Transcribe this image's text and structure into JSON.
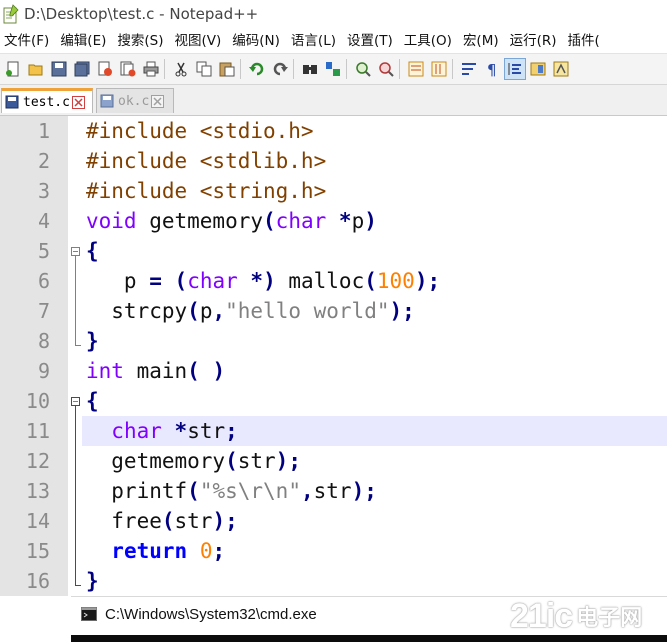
{
  "window": {
    "title": "D:\\Desktop\\test.c - Notepad++"
  },
  "menu": [
    "文件(F)",
    "编辑(E)",
    "搜索(S)",
    "视图(V)",
    "编码(N)",
    "语言(L)",
    "设置(T)",
    "工具(O)",
    "宏(M)",
    "运行(R)",
    "插件("
  ],
  "toolbar": {
    "icons": [
      "new-file-icon",
      "open-file-icon",
      "save-icon",
      "save-all-icon",
      "close-icon",
      "close-all-icon",
      "print-icon",
      "cut-icon",
      "copy-icon",
      "paste-icon",
      "undo-icon",
      "redo-icon",
      "find-icon",
      "replace-icon",
      "zoom-in-icon",
      "zoom-out-icon",
      "sync-vertical-icon",
      "sync-horizontal-icon",
      "word-wrap-icon",
      "show-all-chars-icon",
      "indent-guide-icon",
      "document-map-icon",
      "function-list-icon"
    ]
  },
  "tabs": [
    {
      "label": "test.c",
      "active": true
    },
    {
      "label": "ok.c",
      "active": false
    }
  ],
  "editor": {
    "line_numbers": [
      "1",
      "2",
      "3",
      "4",
      "5",
      "6",
      "7",
      "8",
      "9",
      "10",
      "11",
      "12",
      "13",
      "14",
      "15",
      "16"
    ],
    "current_line": 11
  },
  "cmd": {
    "title": "C:\\Windows\\System32\\cmd.exe"
  },
  "watermark": {
    "logo_text": "21ic",
    "cn_text": "电子网"
  },
  "colors": {
    "preprocessor": "#804000",
    "type_keyword": "#8000ff",
    "instruction_keyword": "#0000ff",
    "string": "#808080",
    "number": "#ff8000",
    "operator": "#000080",
    "current_line_bg": "#e8e8ff",
    "gutter_bg": "#e4e4e4",
    "tab_active_accent": "#f0a23a",
    "fold_marker": "#ff0000"
  }
}
